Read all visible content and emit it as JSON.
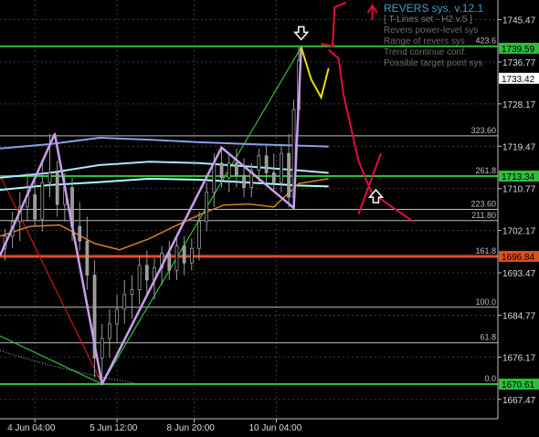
{
  "chart_data": {
    "type": "line",
    "title": "REVERS sys. v.12.1",
    "subtitle": "[ T-Lines set - H2 v.5 ]",
    "legend": [
      "Revers power-level sys",
      "Range of revers sys",
      "Trend continue conf.",
      "Possible target point sys"
    ],
    "ylim": [
      1663.5,
      1749.5
    ],
    "y_ticks": [
      "1745.47",
      "1736.77",
      "1728.17",
      "1719.47",
      "1710.77",
      "1702.17",
      "1693.47",
      "1684.77",
      "1676.17",
      "1667.47"
    ],
    "x_ticks": [
      "4 Jun 04:00",
      "5 Jun 12:00",
      "8 Jun 20:00",
      "10 Jun 04:00"
    ],
    "x_tick_pos": [
      0.07,
      0.235,
      0.39,
      0.555
    ],
    "price_labels": [
      {
        "text": "1739.59",
        "value": 1739.59,
        "color": "#2ebf3a"
      },
      {
        "text": "1733.42",
        "value": 1733.42,
        "color": "#ffffff"
      },
      {
        "text": "1713.34",
        "value": 1713.34,
        "color": "#2ebf3a"
      },
      {
        "text": "1696.84",
        "value": 1696.84,
        "color": "#e0501a"
      },
      {
        "text": "1670.61",
        "value": 1670.61,
        "color": "#2ebf3a"
      }
    ],
    "levels": [
      {
        "text": "423.6",
        "value": 1740.0,
        "color": "#2ebf3a",
        "width": 2
      },
      {
        "text": "323.60",
        "value": 1721.6,
        "color": "#bfbfbf",
        "width": 1
      },
      {
        "text": "261.8",
        "value": 1713.34,
        "color": "#2ebf3a",
        "width": 2
      },
      {
        "text": "223.60",
        "value": 1706.5,
        "color": "#bfbfbf",
        "width": 1
      },
      {
        "text": "211.80",
        "value": 1704.2,
        "color": "#bfbfbf",
        "width": 1
      },
      {
        "text": "161.8",
        "value": 1696.84,
        "color": "#e0501a",
        "width": 3
      },
      {
        "text": "100.0",
        "value": 1686.4,
        "color": "#bfbfbf",
        "width": 1
      },
      {
        "text": "61.8",
        "value": 1679.1,
        "color": "#bfbfbf",
        "width": 1
      },
      {
        "text": "0.0",
        "value": 1670.61,
        "color": "#2ebf3a",
        "width": 2
      }
    ],
    "zigzag": {
      "color": "#c8a0ec",
      "x": [
        0.0,
        0.11,
        0.205,
        0.445,
        0.59,
        0.605
      ],
      "y": [
        1697.0,
        1722.0,
        1670.61,
        1719.2,
        1706.8,
        1739.8
      ]
    },
    "projection": {
      "color": "#e8e000",
      "x": [
        0.605,
        0.625,
        0.645,
        0.66
      ],
      "y": [
        1739.8,
        1733.2,
        1729.5,
        1735.5
      ]
    },
    "hand_drawn": {
      "color": "#e0103a",
      "x": [
        0.66,
        0.68,
        0.69,
        0.72,
        0.745,
        0.78,
        0.83
      ],
      "y": [
        1739.3,
        1737.5,
        1730.0,
        1716.5,
        1710.2,
        1707.5,
        1704.0
      ]
    },
    "band_upper": {
      "color": "#8aa0e8",
      "x": [
        0.0,
        0.1,
        0.2,
        0.3,
        0.4,
        0.5,
        0.6,
        0.66
      ],
      "y": [
        1719.0,
        1719.9,
        1721.2,
        1720.8,
        1720.3,
        1719.9,
        1719.6,
        1719.4
      ]
    },
    "band_mid": {
      "color": "#a8e8ff",
      "x": [
        0.0,
        0.1,
        0.2,
        0.3,
        0.4,
        0.5,
        0.6,
        0.66
      ],
      "y": [
        1713.0,
        1714.0,
        1715.6,
        1716.3,
        1716.0,
        1715.3,
        1714.5,
        1714.0
      ]
    },
    "band_lower": {
      "color": "#b0ffff",
      "x": [
        0.0,
        0.1,
        0.2,
        0.3,
        0.4,
        0.5,
        0.6,
        0.66
      ],
      "y": [
        1710.5,
        1711.5,
        1712.1,
        1712.8,
        1712.6,
        1712.0,
        1711.4,
        1711.2
      ]
    },
    "orange_line": {
      "color": "#d6802a",
      "x": [
        0.0,
        0.06,
        0.12,
        0.19,
        0.24,
        0.3,
        0.35,
        0.41,
        0.45,
        0.5,
        0.55,
        0.6,
        0.66
      ],
      "y": [
        1701.0,
        1703.0,
        1703.3,
        1699.5,
        1698.2,
        1700.5,
        1703.0,
        1705.8,
        1707.4,
        1707.6,
        1707.0,
        1711.8,
        1712.8
      ]
    },
    "red_trend": {
      "color": "#c8171c",
      "x": [
        0.0,
        0.205
      ],
      "y": [
        1713.5,
        1670.61
      ]
    },
    "green_trend": [
      {
        "color": "#2ebf3a",
        "x": [
          0.0,
          0.205
        ],
        "y": [
          1680.5,
          1670.61
        ]
      },
      {
        "color": "#2ebf3a",
        "x": [
          0.205,
          0.605
        ],
        "y": [
          1670.61,
          1739.8
        ]
      }
    ],
    "arrows": [
      {
        "x": 0.605,
        "y": 1742.5,
        "dir": "down"
      },
      {
        "x": 0.755,
        "y": 1709.0,
        "dir": "up"
      },
      {
        "x": 0.748,
        "y": 1748.0,
        "dir": "up-red"
      }
    ],
    "candles": [
      {
        "t": 0.01,
        "o": 1698.5,
        "h": 1702.5,
        "l": 1696.0,
        "c": 1701.0
      },
      {
        "t": 0.025,
        "o": 1701.0,
        "h": 1706.0,
        "l": 1698.5,
        "c": 1704.0
      },
      {
        "t": 0.04,
        "o": 1704.0,
        "h": 1710.0,
        "l": 1700.0,
        "c": 1707.0
      },
      {
        "t": 0.055,
        "o": 1707.0,
        "h": 1714.0,
        "l": 1704.0,
        "c": 1709.5
      },
      {
        "t": 0.07,
        "o": 1709.5,
        "h": 1713.0,
        "l": 1703.0,
        "c": 1704.5
      },
      {
        "t": 0.085,
        "o": 1704.5,
        "h": 1716.0,
        "l": 1702.0,
        "c": 1712.0
      },
      {
        "t": 0.1,
        "o": 1712.0,
        "h": 1722.0,
        "l": 1709.0,
        "c": 1714.0
      },
      {
        "t": 0.115,
        "o": 1714.0,
        "h": 1716.5,
        "l": 1705.0,
        "c": 1707.5
      },
      {
        "t": 0.13,
        "o": 1707.5,
        "h": 1714.0,
        "l": 1704.0,
        "c": 1711.0
      },
      {
        "t": 0.145,
        "o": 1711.0,
        "h": 1713.0,
        "l": 1700.0,
        "c": 1703.0
      },
      {
        "t": 0.16,
        "o": 1703.0,
        "h": 1708.0,
        "l": 1698.0,
        "c": 1700.0
      },
      {
        "t": 0.175,
        "o": 1700.0,
        "h": 1705.0,
        "l": 1690.0,
        "c": 1693.0
      },
      {
        "t": 0.19,
        "o": 1693.0,
        "h": 1696.0,
        "l": 1672.0,
        "c": 1676.0
      },
      {
        "t": 0.205,
        "o": 1676.0,
        "h": 1683.0,
        "l": 1670.6,
        "c": 1680.0
      },
      {
        "t": 0.22,
        "o": 1680.0,
        "h": 1686.0,
        "l": 1676.0,
        "c": 1683.0
      },
      {
        "t": 0.235,
        "o": 1683.0,
        "h": 1689.0,
        "l": 1679.0,
        "c": 1686.0
      },
      {
        "t": 0.25,
        "o": 1686.0,
        "h": 1692.0,
        "l": 1683.0,
        "c": 1689.0
      },
      {
        "t": 0.265,
        "o": 1689.0,
        "h": 1693.0,
        "l": 1684.0,
        "c": 1690.0
      },
      {
        "t": 0.28,
        "o": 1690.0,
        "h": 1697.0,
        "l": 1687.0,
        "c": 1695.0
      },
      {
        "t": 0.295,
        "o": 1695.0,
        "h": 1698.0,
        "l": 1689.0,
        "c": 1692.0
      },
      {
        "t": 0.31,
        "o": 1692.0,
        "h": 1696.5,
        "l": 1688.0,
        "c": 1694.5
      },
      {
        "t": 0.325,
        "o": 1694.5,
        "h": 1699.0,
        "l": 1691.0,
        "c": 1697.5
      },
      {
        "t": 0.34,
        "o": 1697.5,
        "h": 1700.0,
        "l": 1692.0,
        "c": 1694.0
      },
      {
        "t": 0.355,
        "o": 1694.0,
        "h": 1701.0,
        "l": 1692.0,
        "c": 1699.0
      },
      {
        "t": 0.37,
        "o": 1699.0,
        "h": 1701.0,
        "l": 1693.0,
        "c": 1695.5
      },
      {
        "t": 0.385,
        "o": 1695.5,
        "h": 1700.5,
        "l": 1694.0,
        "c": 1698.5
      },
      {
        "t": 0.4,
        "o": 1698.5,
        "h": 1706.0,
        "l": 1696.0,
        "c": 1704.0
      },
      {
        "t": 0.415,
        "o": 1704.0,
        "h": 1712.0,
        "l": 1702.0,
        "c": 1710.0
      },
      {
        "t": 0.43,
        "o": 1710.0,
        "h": 1718.0,
        "l": 1707.0,
        "c": 1716.0
      },
      {
        "t": 0.445,
        "o": 1716.0,
        "h": 1719.5,
        "l": 1711.0,
        "c": 1713.0
      },
      {
        "t": 0.46,
        "o": 1713.0,
        "h": 1718.0,
        "l": 1710.0,
        "c": 1716.0
      },
      {
        "t": 0.475,
        "o": 1716.0,
        "h": 1719.0,
        "l": 1711.0,
        "c": 1713.5
      },
      {
        "t": 0.49,
        "o": 1713.5,
        "h": 1717.0,
        "l": 1709.0,
        "c": 1711.0
      },
      {
        "t": 0.505,
        "o": 1711.0,
        "h": 1716.0,
        "l": 1709.0,
        "c": 1714.5
      },
      {
        "t": 0.52,
        "o": 1714.5,
        "h": 1719.0,
        "l": 1712.0,
        "c": 1717.5
      },
      {
        "t": 0.535,
        "o": 1717.5,
        "h": 1719.5,
        "l": 1712.0,
        "c": 1714.0
      },
      {
        "t": 0.55,
        "o": 1714.0,
        "h": 1718.0,
        "l": 1710.0,
        "c": 1712.0
      },
      {
        "t": 0.565,
        "o": 1712.0,
        "h": 1720.0,
        "l": 1710.0,
        "c": 1718.0
      },
      {
        "t": 0.58,
        "o": 1718.0,
        "h": 1722.0,
        "l": 1707.0,
        "c": 1709.0
      },
      {
        "t": 0.59,
        "o": 1709.0,
        "h": 1729.0,
        "l": 1706.8,
        "c": 1727.0
      },
      {
        "t": 0.6,
        "o": 1727.0,
        "h": 1739.8,
        "l": 1725.0,
        "c": 1737.0
      }
    ]
  }
}
